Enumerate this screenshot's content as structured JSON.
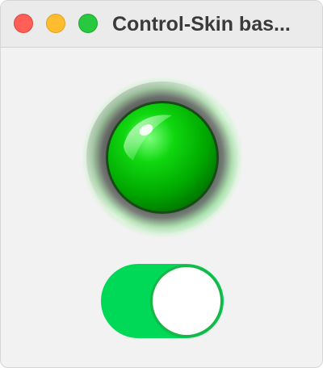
{
  "window": {
    "title": "Control-Skin bas..."
  },
  "titlebar": {
    "buttons": [
      {
        "name": "close",
        "color": "#ff5f57"
      },
      {
        "name": "minimize",
        "color": "#febc2e"
      },
      {
        "name": "zoom",
        "color": "#28c840"
      }
    ]
  },
  "indicator_lamp": {
    "state": "on",
    "color": "#00d000"
  },
  "toggle_switch": {
    "state": "on",
    "track_color": "#00d957",
    "knob_color": "#ffffff"
  }
}
